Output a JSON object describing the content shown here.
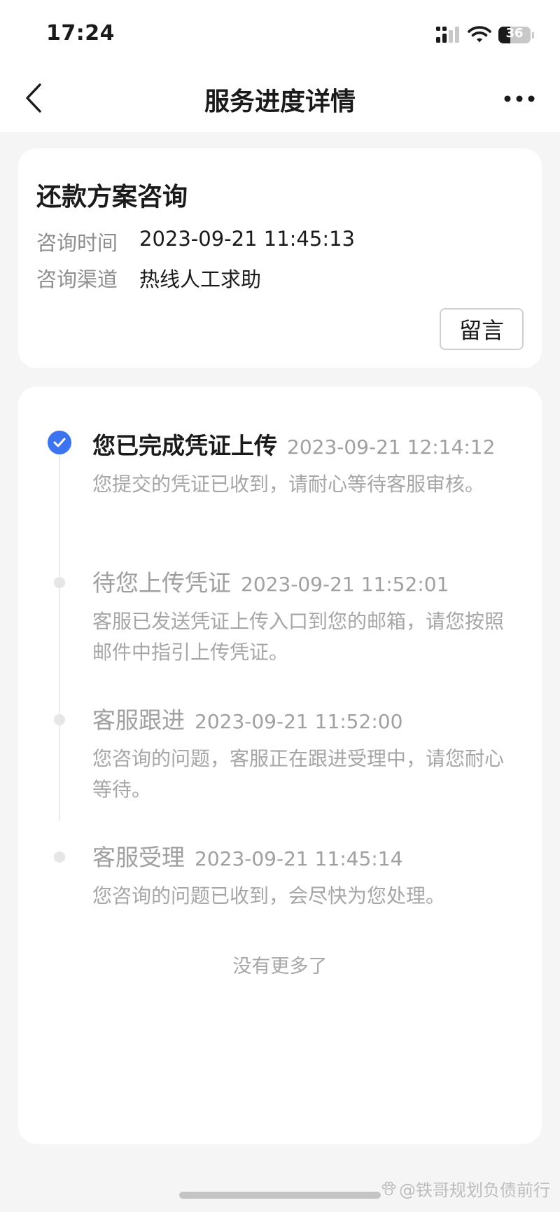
{
  "status_bar": {
    "time": "17:24",
    "battery_text": "36",
    "battery_level_percent": 36,
    "signal_icon": "signal-icon",
    "wifi_icon": "wifi-icon"
  },
  "nav": {
    "title": "服务进度详情",
    "back_icon": "chevron-left-icon",
    "more_icon": "more-horizontal-icon"
  },
  "summary": {
    "title": "还款方案咨询",
    "rows": [
      {
        "label": "咨询时间",
        "value": "2023-09-21 11:45:13"
      },
      {
        "label": "咨询渠道",
        "value": "热线人工求助"
      }
    ],
    "message_button": "留言"
  },
  "timeline": {
    "items": [
      {
        "title": "您已完成凭证上传",
        "time": "2023-09-21 12:14:12",
        "desc": "您提交的凭证已收到，请耐心等待客服审核。",
        "state": "done"
      },
      {
        "title": "待您上传凭证",
        "time": "2023-09-21 11:52:01",
        "desc": "客服已发送凭证上传入口到您的邮箱，请您按照邮件中指引上传凭证。",
        "state": "pending"
      },
      {
        "title": "客服跟进",
        "time": "2023-09-21 11:52:00",
        "desc": "您咨询的问题，客服正在跟进受理中，请您耐心等待。",
        "state": "pending"
      },
      {
        "title": "客服受理",
        "time": "2023-09-21 11:45:14",
        "desc": "您咨询的问题已收到，会尽快为您处理。",
        "state": "pending"
      }
    ],
    "end_note": "没有更多了"
  },
  "watermark": "@铁哥规划负债前行",
  "colors": {
    "accent": "#3c74f0",
    "background": "#f5f5f5",
    "card": "#ffffff",
    "muted_text": "#a0a0a0"
  }
}
